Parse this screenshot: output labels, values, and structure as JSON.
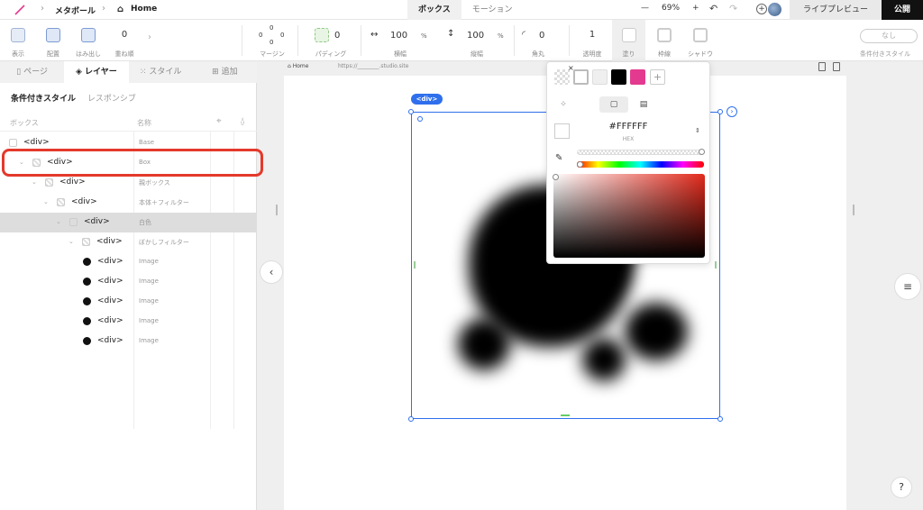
{
  "breadcrumb": {
    "project": "メタボール",
    "page": "Home"
  },
  "top_tabs": [
    "ボックス",
    "モーション"
  ],
  "zoom": {
    "minus": "—",
    "value": "69%",
    "plus": "+"
  },
  "top_actions": {
    "preview": "ライブプレビュー",
    "publish": "公開",
    "add": "+"
  },
  "toolbar": {
    "display": "表示",
    "layout": "配置",
    "overflow": "はみ出し",
    "zindex_value": "0",
    "zindex": "重ね順",
    "margin_top": "0",
    "margin_left": "0",
    "margin_right": "0",
    "margin_bottom": "0",
    "margin": "マージン",
    "padding_value": "0",
    "padding": "パディング",
    "width_value": "100",
    "width_unit": "%",
    "width": "横幅",
    "height_value": "100",
    "height_unit": "%",
    "height": "縦幅",
    "radius_value": "0",
    "radius": "角丸",
    "opacity_value": "1",
    "opacity": "透明度",
    "fill": "塗り",
    "stroke": "枠線",
    "shadow": "シャドウ",
    "cond_value": "なし",
    "cond_style": "条件付きスタイル"
  },
  "sidebar": {
    "tabs": [
      {
        "icon": "page-icon",
        "label": "ページ"
      },
      {
        "icon": "layer-icon",
        "label": "レイヤー"
      },
      {
        "icon": "style-icon",
        "label": "スタイル"
      },
      {
        "icon": "add-icon",
        "label": "追加"
      }
    ],
    "subtabs": [
      "条件付きスタイル",
      "レスポンシブ"
    ],
    "columns": {
      "box": "ボックス",
      "name": "名称"
    },
    "rows": [
      {
        "tag": "<div>",
        "name": "Base"
      },
      {
        "tag": "<div>",
        "name": "Box"
      },
      {
        "tag": "<div>",
        "name": "親ボックス"
      },
      {
        "tag": "<div>",
        "name": "本体＋フィルター"
      },
      {
        "tag": "<div>",
        "name": "白色"
      },
      {
        "tag": "<div>",
        "name": "ぼかしフィルター"
      },
      {
        "tag": "<div>",
        "name": "Image"
      },
      {
        "tag": "<div>",
        "name": "Image"
      },
      {
        "tag": "<div>",
        "name": "Image"
      },
      {
        "tag": "<div>",
        "name": "Image"
      },
      {
        "tag": "<div>",
        "name": "Image"
      }
    ]
  },
  "canvas": {
    "home_label": "Home",
    "url": "https://________.studio.site",
    "selected_badge": "<div>"
  },
  "color_picker": {
    "swatches": [
      "#FFFFFF",
      "#EFEFEF",
      "#000000",
      "#E33A8F"
    ],
    "remove": "×",
    "add_swatch": "+",
    "hex_value": "#FFFFFF",
    "hex_label": "HEX"
  },
  "help": "?"
}
